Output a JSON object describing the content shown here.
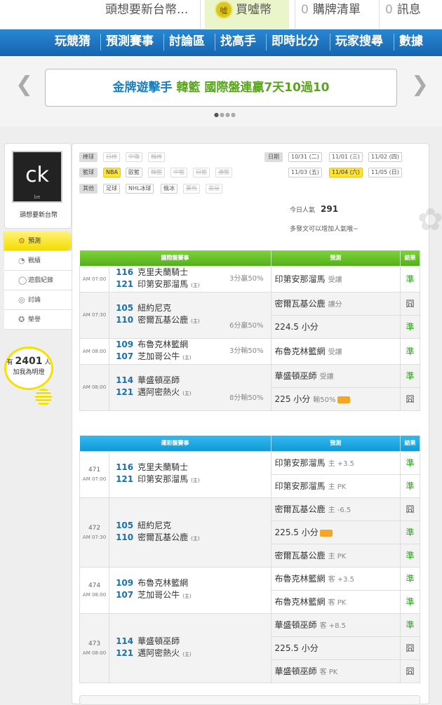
{
  "topbar": {
    "user": "頭想要新台幣...",
    "coin_label": "買噓幣",
    "coin_icon": "噓",
    "cart_count": "0",
    "cart_label": "購牌清單",
    "msg_count": "0",
    "msg_label": "訊息"
  },
  "nav": [
    "玩競猜",
    "預測賽事",
    "討論區",
    "找高手",
    "即時比分",
    "玩家搜尋",
    "數據"
  ],
  "banner": {
    "prefix": "金牌遊擊手",
    "highlight": "韓籃",
    "suffix": "國際盤連贏7天10過10"
  },
  "profile": {
    "name": "頭想要新台幣",
    "avatar_text": "ck",
    "avatar_sub": "be"
  },
  "menu": [
    {
      "label": "預測",
      "icon": "gear-icon"
    },
    {
      "label": "戰績",
      "icon": "chart-icon"
    },
    {
      "label": "遊戲紀錄",
      "icon": "record-icon"
    },
    {
      "label": "討論",
      "icon": "chat-icon"
    },
    {
      "label": "榮譽",
      "icon": "medal-icon"
    }
  ],
  "likes": {
    "prefix": "有",
    "count": "2401",
    "unit": "人",
    "text": "加我為明燈"
  },
  "filter": {
    "baseball_label": "棒球",
    "baseball": [
      "日棒",
      "中職",
      "韓棒"
    ],
    "basketball_label": "籃球",
    "basketball": [
      "NBA",
      "歐籃",
      "韓籃",
      "中籃",
      "日籃",
      "澳籃"
    ],
    "other_label": "其他",
    "other": [
      "足球",
      "NHL冰球",
      "俄冰",
      "賽馬",
      "美足"
    ],
    "date_label": "日期",
    "dates": [
      "10/31 (二)",
      "11/01 (三)",
      "11/02 (四)",
      "11/03 (五)",
      "11/04 (六)",
      "11/05 (日)"
    ]
  },
  "stats": {
    "popularity_label": "今日人氣",
    "popularity": "291",
    "hint": "多發文可以增加人氣哦~"
  },
  "intl": {
    "header": [
      "國際盤賽事",
      "預測",
      "結果"
    ],
    "games": [
      {
        "time": "AM 07:00",
        "away_no": "116",
        "away": "克里夫蘭騎士",
        "home_no": "121",
        "home": "印第安那溜馬",
        "home_tag": "(主)",
        "result": "3分贏50%",
        "preds": [
          {
            "text": "印第安那溜馬",
            "sub": "受讓",
            "res": "準"
          }
        ]
      },
      {
        "time": "AM 07:30",
        "away_no": "105",
        "away": "紐約尼克",
        "home_no": "110",
        "home": "密爾瓦基公鹿",
        "home_tag": "(主)",
        "result": "6分贏50%",
        "preds": [
          {
            "text": "密爾瓦基公鹿",
            "sub": "讓分",
            "res": "囧"
          },
          {
            "text": "224.5 小分",
            "sub": "",
            "res": "準"
          }
        ]
      },
      {
        "time": "AM 08:00",
        "away_no": "109",
        "away": "布魯克林籃網",
        "home_no": "107",
        "home": "芝加哥公牛",
        "home_tag": "(主)",
        "result": "3分輸50%",
        "preds": [
          {
            "text": "布魯克林籃網",
            "sub": "受讓",
            "res": "準"
          }
        ]
      },
      {
        "time": "AM 08:00",
        "away_no": "114",
        "away": "華盛頓巫師",
        "home_no": "121",
        "home": "邁阿密熱火",
        "home_tag": "(主)",
        "result": "8分輸50%",
        "preds": [
          {
            "text": "華盛頓巫師",
            "sub": "受讓",
            "res": "準"
          },
          {
            "text": "225 小分",
            "sub": "輸50%",
            "res": "囧"
          }
        ]
      }
    ]
  },
  "lottery": {
    "header": [
      "運彩盤賽事",
      "預測",
      "結果"
    ],
    "games": [
      {
        "no": "471",
        "time": "AM 07:00",
        "away_no": "116",
        "away": "克里夫蘭騎士",
        "home_no": "121",
        "home": "印第安那溜馬",
        "home_tag": "(主)",
        "preds": [
          {
            "text": "印第安那溜馬",
            "sub": "主 +3.5",
            "res": "準"
          },
          {
            "text": "印第安那溜馬",
            "sub": "主 PK",
            "res": "準"
          }
        ]
      },
      {
        "no": "472",
        "time": "AM 07:30",
        "away_no": "105",
        "away": "紐約尼克",
        "home_no": "110",
        "home": "密爾瓦基公鹿",
        "home_tag": "(主)",
        "preds": [
          {
            "text": "密爾瓦基公鹿",
            "sub": "主 -6.5",
            "res": "囧"
          },
          {
            "text": "225.5 小分",
            "sub": "",
            "res": "準"
          },
          {
            "text": "密爾瓦基公鹿",
            "sub": "主 PK",
            "res": "準"
          }
        ]
      },
      {
        "no": "474",
        "time": "AM 08:00",
        "away_no": "109",
        "away": "布魯克林籃網",
        "home_no": "107",
        "home": "芝加哥公牛",
        "home_tag": "(主)",
        "preds": [
          {
            "text": "布魯克林籃網",
            "sub": "客 +3.5",
            "res": "準"
          },
          {
            "text": "布魯克林籃網",
            "sub": "客 PK",
            "res": "準"
          }
        ]
      },
      {
        "no": "473",
        "time": "AM 08:00",
        "away_no": "114",
        "away": "華盛頓巫師",
        "home_no": "121",
        "home": "邁阿密熱火",
        "home_tag": "(主)",
        "preds": [
          {
            "text": "華盛頓巫師",
            "sub": "客 +8.5",
            "res": "準"
          },
          {
            "text": "225.5 小分",
            "sub": "",
            "res": "囧"
          },
          {
            "text": "華盛頓巫師",
            "sub": "客 PK",
            "res": "囧"
          }
        ]
      }
    ]
  }
}
